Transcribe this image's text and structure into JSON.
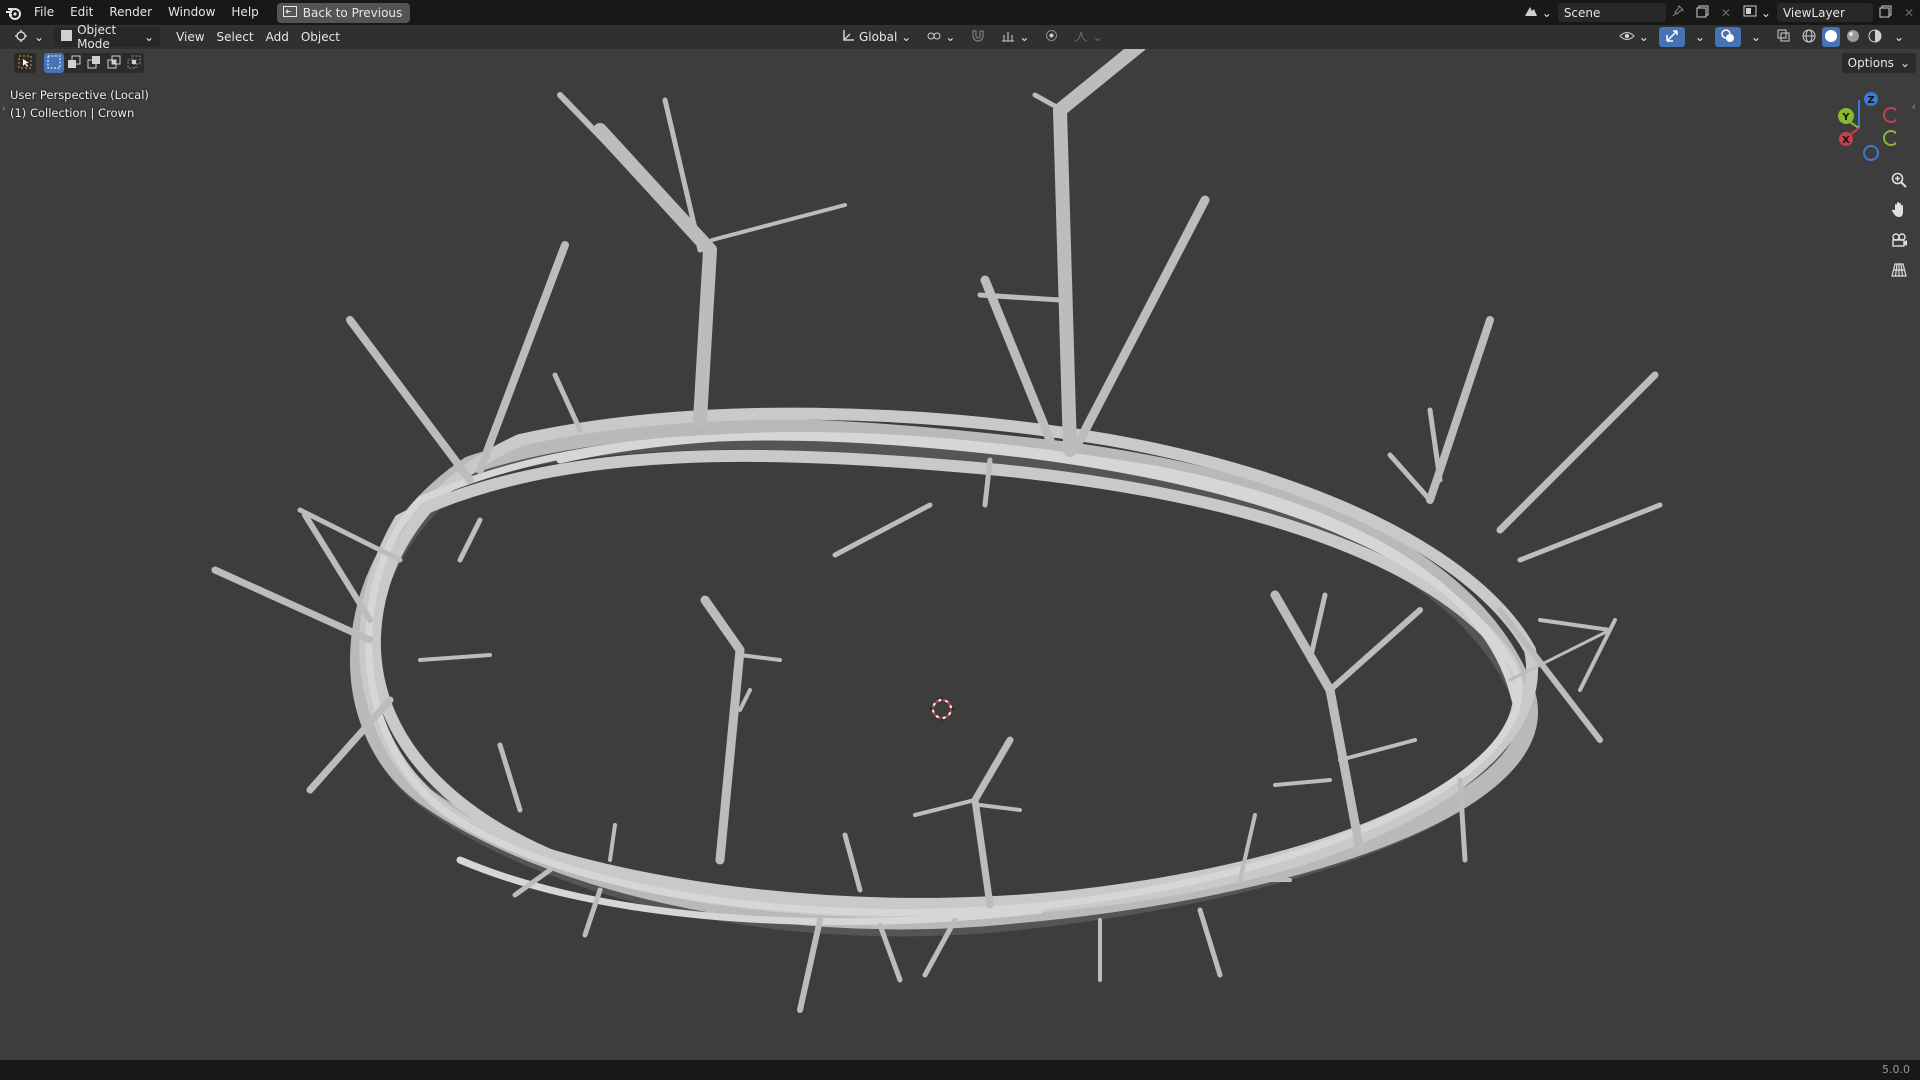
{
  "menu": {
    "file": "File",
    "edit": "Edit",
    "render": "Render",
    "window": "Window",
    "help": "Help",
    "back_to_previous": "Back to Previous"
  },
  "topright": {
    "scene": "Scene",
    "view_layer": "ViewLayer"
  },
  "header": {
    "mode": "Object Mode",
    "view": "View",
    "select": "Select",
    "add": "Add",
    "object": "Object",
    "orientation": "Global",
    "options": "Options"
  },
  "viewport": {
    "perspective": "User Perspective (Local)",
    "collection": "(1) Collection | Crown"
  },
  "gizmo": {
    "x": "X",
    "y": "Y",
    "z": "Z"
  },
  "status": {
    "version": "5.0.0"
  },
  "colors": {
    "background": "#3d3d3d",
    "topbar": "#181818",
    "header": "#303030",
    "mesh": "#bdbdbd",
    "x_axis": "#c8404b",
    "y_axis": "#88b92f",
    "z_axis": "#3b7ad2",
    "cursor_red": "#d83a3a"
  }
}
